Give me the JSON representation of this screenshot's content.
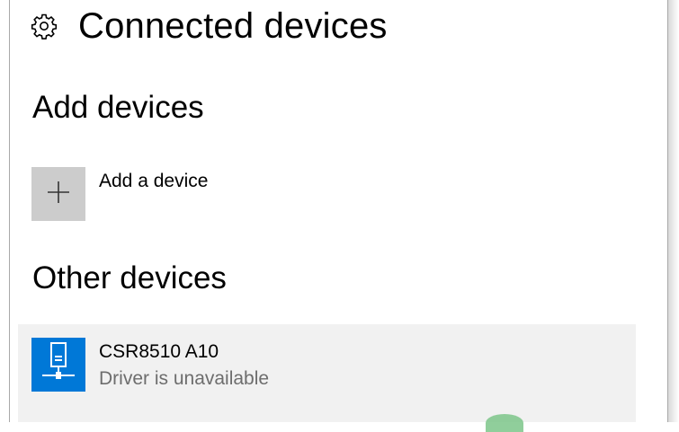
{
  "header": {
    "title": "Connected devices",
    "icon": "gear-icon"
  },
  "add_section": {
    "heading": "Add devices",
    "add_button_label": "Add a device",
    "add_icon": "plus-icon"
  },
  "other_section": {
    "heading": "Other devices",
    "devices": [
      {
        "name": "CSR8510 A10",
        "status": "Driver is unavailable",
        "icon": "usb-device-icon"
      }
    ]
  },
  "colors": {
    "accent": "#0078d7",
    "tile_gray": "#cccccc",
    "row_highlight": "#f1f1f1",
    "secondary_text": "#6d6d6d"
  }
}
